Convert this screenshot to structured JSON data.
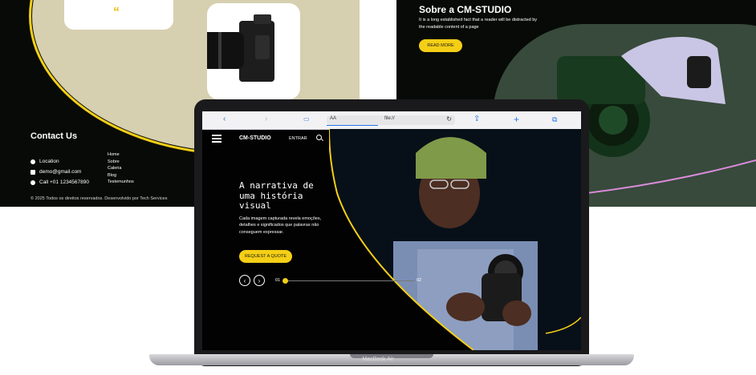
{
  "left_panel": {
    "quote_mark": "“",
    "contact_title": "Contact Us",
    "contacts": [
      {
        "icon": "location-pin-icon",
        "text": "Location"
      },
      {
        "icon": "mail-icon",
        "text": "demo@gmail.com"
      },
      {
        "icon": "phone-icon",
        "text": "Call +01 1234567890"
      }
    ],
    "links": [
      "Home",
      "Sobre",
      "Caleria",
      "Blog",
      "Testemunhos"
    ],
    "copyright": "© 2025 Todos os direitos reservados. Desenvolvido por Tech Services"
  },
  "right_panel": {
    "title": "Sobre a CM-STUDIO",
    "description": "It is a long established fact that a reader will be distracted by the readable content of a page",
    "button": "READ MORE"
  },
  "browser": {
    "aa": "AA",
    "url": "file://",
    "icons": [
      "back-icon",
      "forward-icon",
      "book-icon",
      "reload-icon",
      "share-icon",
      "add-icon",
      "tabs-icon"
    ]
  },
  "site": {
    "brand": "CM-STUDIO",
    "entrar": "ENTRAR",
    "hero_title": "A narrativa de uma história visual",
    "hero_sub": "Cada imagem capturada revela emoções, detalhes e significados que palavras não conseguem expressar.",
    "cta": "REQUEST A QUOTE",
    "slide_current": "01",
    "slide_total": "02"
  },
  "laptop_label": "MacBook Air",
  "colors": {
    "accent": "#f5cf16",
    "dark": "#070a07",
    "beige": "#d6cfb0"
  }
}
